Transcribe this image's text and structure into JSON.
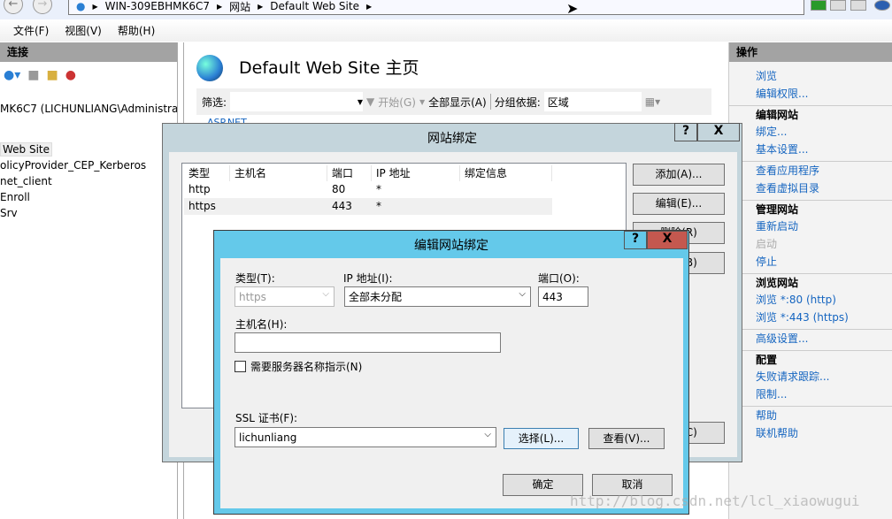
{
  "address": {
    "segments": [
      "WIN-309EBHMK6C7",
      "网站",
      "Default Web Site"
    ]
  },
  "menu": [
    "文件(F)",
    "视图(V)",
    "帮助(H)"
  ],
  "connections": {
    "title": "连接",
    "server": "MK6C7 (LICHUNLIANG\\Administrat",
    "items": [
      "Web Site",
      "olicyProvider_CEP_Kerberos",
      "net_client",
      "Enroll",
      "Srv"
    ]
  },
  "center": {
    "title": "Default Web Site 主页",
    "filter_label": "筛选:",
    "start": "开始(G)",
    "show_all": "全部显示(A)",
    "group_label": "分组依据:",
    "group_value": "区域",
    "partial": "ASP.NET"
  },
  "actions": {
    "title": "操作",
    "groups": [
      {
        "items": [
          "浏览",
          "编辑权限..."
        ]
      },
      {
        "header": "编辑网站",
        "items": [
          "绑定...",
          "基本设置..."
        ]
      },
      {
        "items": [
          "查看应用程序",
          "查看虚拟目录"
        ]
      },
      {
        "header": "管理网站",
        "items": [
          "重新启动",
          "启动",
          "停止"
        ],
        "disabled": [
          "启动"
        ]
      },
      {
        "header": "浏览网站",
        "items": [
          "浏览 *:80 (http)",
          "浏览 *:443 (https)"
        ]
      },
      {
        "items": [
          "高级设置..."
        ]
      },
      {
        "header": "配置",
        "items": [
          "失败请求跟踪...",
          "限制..."
        ]
      },
      {
        "items": [
          "帮助",
          "联机帮助"
        ]
      }
    ]
  },
  "bindings_dialog": {
    "title": "网站绑定",
    "help": "?",
    "close": "X",
    "columns": [
      "类型",
      "主机名",
      "端口",
      "IP 地址",
      "绑定信息"
    ],
    "rows": [
      [
        "http",
        "",
        "80",
        "*",
        ""
      ],
      [
        "https",
        "",
        "443",
        "*",
        ""
      ]
    ],
    "buttons": {
      "add": "添加(A)...",
      "edit": "编辑(E)...",
      "remove": "删除(R)",
      "browse": "浏览(B)",
      "close": "关闭(C)"
    }
  },
  "edit_dialog": {
    "title": "编辑网站绑定",
    "help": "?",
    "close": "X",
    "type_label": "类型(T):",
    "type_value": "https",
    "ip_label": "IP 地址(I):",
    "ip_value": "全部未分配",
    "port_label": "端口(O):",
    "port_value": "443",
    "host_label": "主机名(H):",
    "host_value": "",
    "sni_label": "需要服务器名称指示(N)",
    "sni_checked": false,
    "ssl_label": "SSL 证书(F):",
    "ssl_value": "lichunliang",
    "select": "选择(L)...",
    "view": "查看(V)...",
    "ok": "确定",
    "cancel": "取消"
  },
  "watermark": "http://blog.csdn.net/lcl_xiaowugui"
}
